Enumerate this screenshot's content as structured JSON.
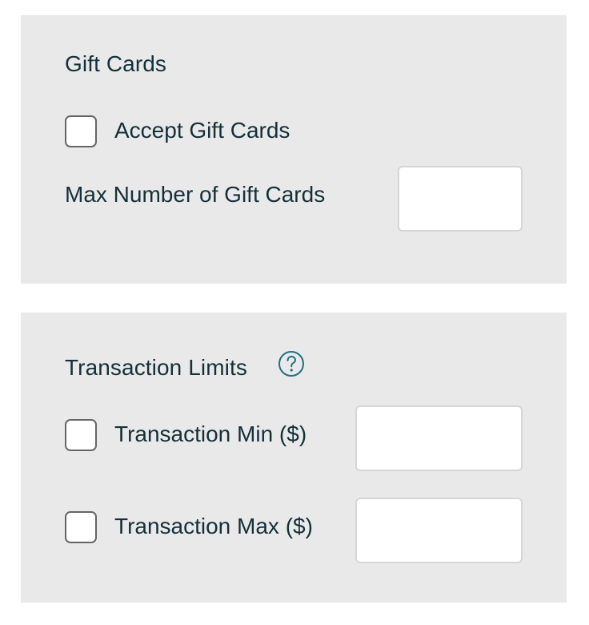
{
  "gift_cards": {
    "title": "Gift Cards",
    "accept_label": "Accept Gift Cards",
    "accept_checked": false,
    "max_number_label": "Max Number of Gift Cards",
    "max_number_value": ""
  },
  "transaction_limits": {
    "title": "Transaction Limits",
    "help_icon": "question-circle-icon",
    "min_label": "Transaction Min ($)",
    "min_checked": false,
    "min_value": "",
    "max_label": "Transaction Max ($)",
    "max_checked": false,
    "max_value": ""
  },
  "colors": {
    "panel_background": "#e9e9e9",
    "text": "#14303a",
    "accent": "#1f6f86",
    "checkbox_border": "#666666"
  }
}
